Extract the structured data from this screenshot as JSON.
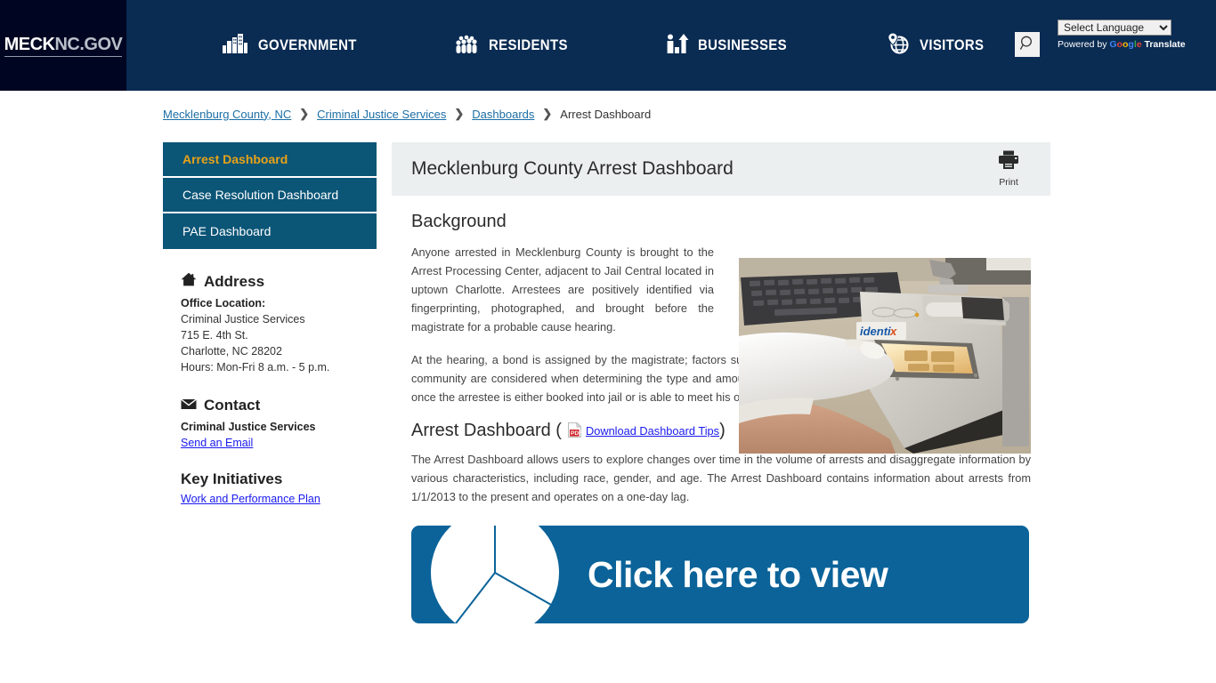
{
  "header": {
    "logo": {
      "bold": "MECK",
      "rest": "NC.GOV"
    },
    "nav": [
      {
        "label": "GOVERNMENT",
        "icon": "buildings-icon"
      },
      {
        "label": "RESIDENTS",
        "icon": "people-icon"
      },
      {
        "label": "BUSINESSES",
        "icon": "business-person-arrow-icon"
      },
      {
        "label": "VISITORS",
        "icon": "globe-pin-icon"
      }
    ],
    "search_icon": "search-icon",
    "language": {
      "selected": "Select Language",
      "options": [
        "Select Language"
      ],
      "powered_prefix": "Powered by",
      "google": "Google",
      "translate": "Translate"
    }
  },
  "breadcrumb": {
    "items": [
      {
        "label": "Mecklenburg County, NC",
        "link": true
      },
      {
        "label": "Criminal Justice Services",
        "link": true
      },
      {
        "label": "Dashboards",
        "link": true
      },
      {
        "label": "Arrest Dashboard",
        "link": false
      }
    ],
    "separator": "❯"
  },
  "sidebar": {
    "nav": [
      {
        "label": "Arrest Dashboard",
        "active": true
      },
      {
        "label": "Case Resolution Dashboard",
        "active": false
      },
      {
        "label": "PAE Dashboard",
        "active": false
      }
    ],
    "address": {
      "heading": "Address",
      "icon": "home-icon",
      "office_label": "Office Location:",
      "lines": [
        "Criminal Justice Services",
        "715 E. 4th St.",
        "Charlotte, NC 28202",
        "Hours: Mon-Fri  8 a.m. - 5 p.m."
      ]
    },
    "contact": {
      "heading": "Contact",
      "icon": "envelope-icon",
      "name": "Criminal Justice Services",
      "email_link": "Send an Email"
    },
    "key_initiatives": {
      "heading": "Key Initiatives",
      "link": "Work and Performance Plan"
    }
  },
  "main": {
    "title": "Mecklenburg County Arrest Dashboard",
    "print": {
      "label": "Print",
      "icon": "printer-icon"
    },
    "background": {
      "heading": "Background",
      "paragraph1": "Anyone arrested in Mecklenburg County is brought to the Arrest Processing Center, adjacent to Jail Central located in uptown Charlotte. Arrestees are positively identified via fingerprinting, photographed, and brought before the magistrate for a probable cause hearing.",
      "paragraph2": "At the hearing, a bond is assigned by the magistrate; factors such as severity of the crime, risk of flight, and risk to the community are considered when determining the type and amount of bond set. The arrest processing stage is complete once the arrestee is either booked into jail or is able to meet his or her bond obligation, prior to being booked.",
      "photo_alt": "gloved-hand-fingerprint-scanner-photo"
    },
    "dashboard_section": {
      "heading_prefix": "Arrest Dashboard (",
      "heading_suffix": ")",
      "pdf_icon": "pdf-icon",
      "pdf_link": "Download Dashboard Tips",
      "paragraph": "The Arrest Dashboard allows users to explore changes over time in the volume of arrests and disaggregate information by various characteristics, including race, gender, and age. The Arrest Dashboard contains information about arrests from 1/1/2013 to the present and operates on a one-day lag."
    },
    "banner": {
      "text": "Click here to view",
      "icon": "pie-chart-icon",
      "color": "#0b6399"
    }
  },
  "colors": {
    "header_bg": "#0a2b52",
    "logo_bg": "#000522",
    "sidebar_item": "#0b5577",
    "sidebar_active_text": "#e8a317",
    "panel_header": "#eceff0",
    "link": "#1a1aee",
    "breadcrumb_link": "#1b6ea5",
    "banner": "#0b6399"
  }
}
